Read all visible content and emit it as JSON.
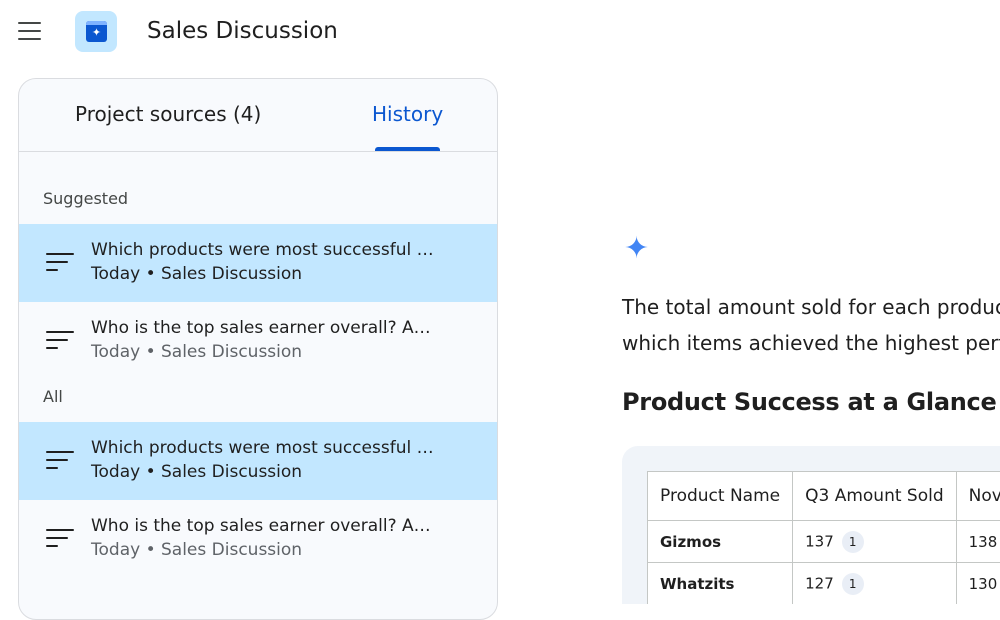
{
  "header": {
    "title": "Sales Discussion"
  },
  "tabs": {
    "sources": "Project sources (4)",
    "history": "History"
  },
  "history": {
    "suggested_label": "Suggested",
    "all_label": "All",
    "suggested": [
      {
        "title": "Which products were most successful …",
        "meta": "Today • Sales Discussion",
        "selected": true
      },
      {
        "title": "Who is the top sales earner overall? A…",
        "meta": "Today • Sales Discussion",
        "selected": false
      }
    ],
    "all": [
      {
        "title": "Which products were most successful …",
        "meta": "Today • Sales Discussion",
        "selected": true
      },
      {
        "title": "Who is the top sales earner overall? A…",
        "meta": "Today • Sales Discussion",
        "selected": false
      }
    ]
  },
  "answer": {
    "line1": "The total amount sold for each product",
    "line2": "which items achieved the highest perfor",
    "heading": "Product Success at a Glance",
    "table": {
      "headers": [
        "Product Name",
        "Q3 Amount Sold",
        "Nov"
      ],
      "rows": [
        {
          "name": "Gizmos",
          "q3": "137",
          "q3_cite": "1",
          "nov": "138"
        },
        {
          "name": "Whatzits",
          "q3": "127",
          "q3_cite": "1",
          "nov": "130"
        }
      ]
    }
  },
  "colors": {
    "accent": "#0b57d0",
    "selected_bg": "#c2e7ff",
    "spark": "#4285f4"
  }
}
